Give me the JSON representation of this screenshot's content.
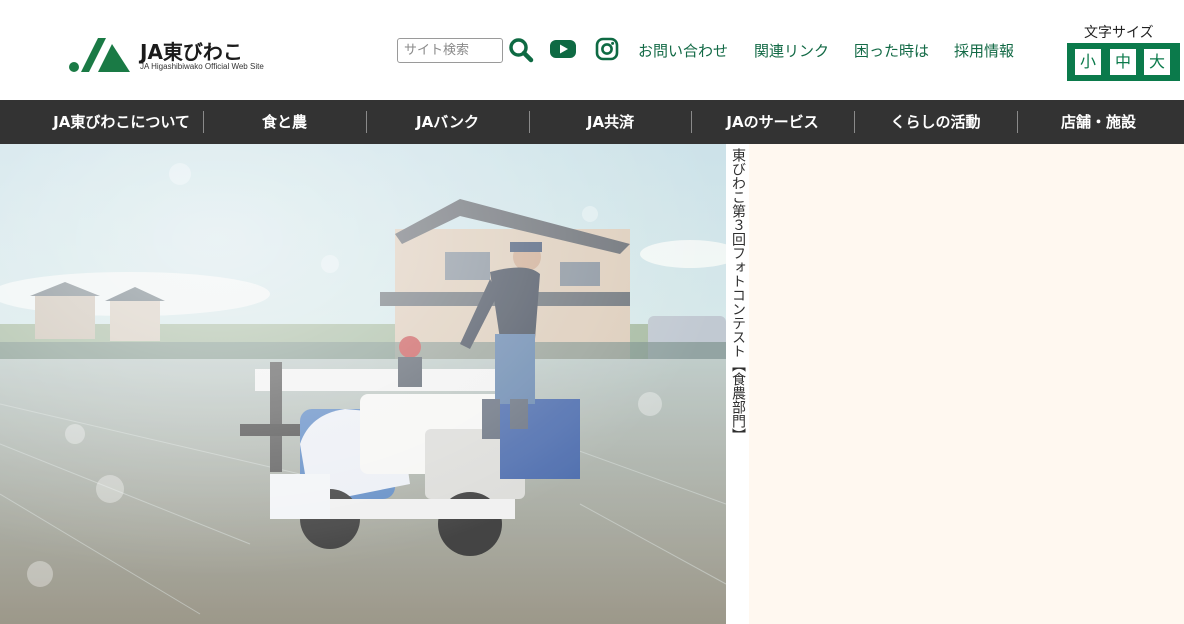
{
  "header": {
    "logo_title": "JA東びわこ",
    "logo_subtitle": "JA Higashibiwako Official Web Site",
    "search_placeholder": "サイト検索",
    "icons": [
      "search-icon",
      "youtube-icon",
      "instagram-icon"
    ],
    "links": [
      "お問い合わせ",
      "関連リンク",
      "困った時は",
      "採用情報"
    ],
    "font_size": {
      "label": "文字サイズ",
      "options": [
        "小",
        "中",
        "大"
      ]
    }
  },
  "nav": {
    "items": [
      "JA東びわこについて",
      "食と農",
      "JAバンク",
      "JA共済",
      "JAのサービス",
      "くらしの活動",
      "店舗・施設"
    ]
  },
  "hero": {
    "caption": "東びわこ第３回フォトコンテスト【食農部門】"
  },
  "colors": {
    "brand_green": "#0b7a4b",
    "link_green": "#136a46",
    "nav_bg": "#333333",
    "side_panel_bg": "#fff8f0"
  }
}
